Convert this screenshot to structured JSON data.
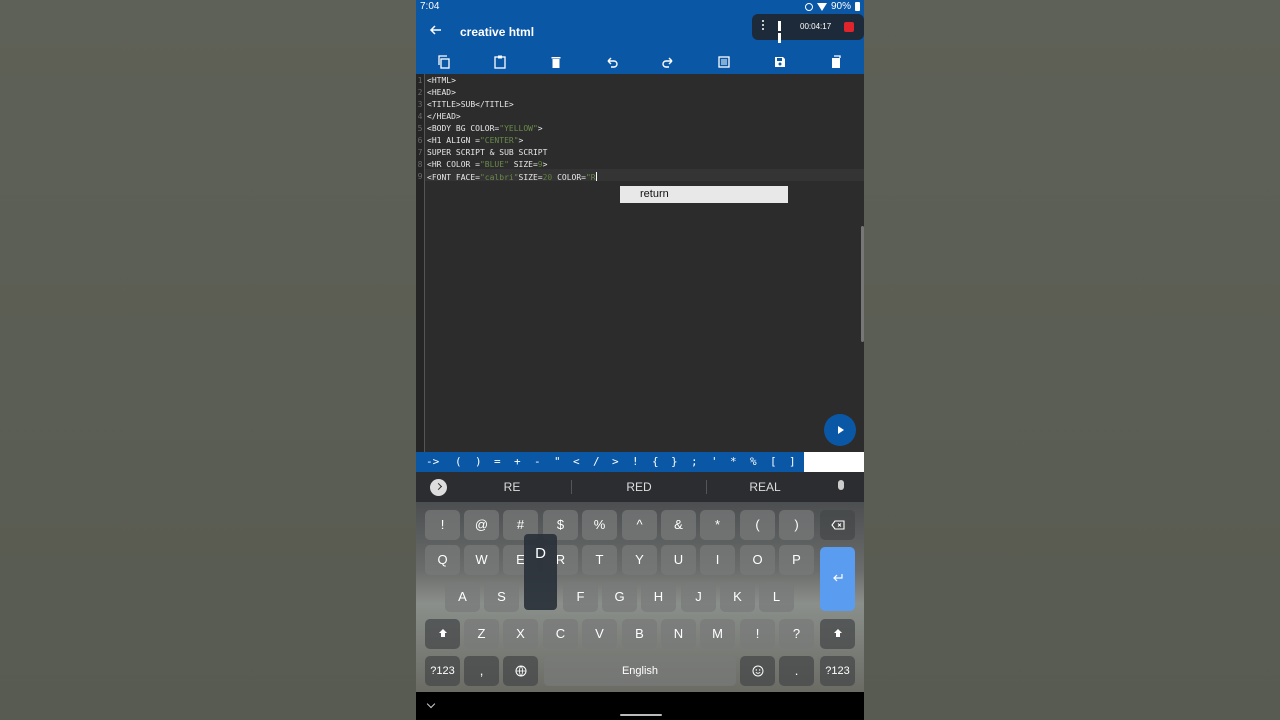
{
  "status": {
    "time": "7:04",
    "battery": "90%"
  },
  "app": {
    "title": "creative html"
  },
  "recorder": {
    "time": "00:04:17"
  },
  "toolbar": {
    "icons": [
      "copy-icon",
      "paste-icon",
      "delete-icon",
      "undo-icon",
      "redo-icon",
      "select-all-icon",
      "save-icon",
      "clipboard-icon"
    ]
  },
  "editor": {
    "line_numbers": [
      "1",
      "2",
      "3",
      "4",
      "5",
      "6",
      "7",
      "8",
      "9"
    ],
    "lines": {
      "l1": "<HTML>",
      "l2": "<HEAD>",
      "l3": "<TITLE>SUB</TITLE>",
      "l4": "</HEAD>",
      "l5a": "<BODY BG COLOR=",
      "l5b": "\"YELLOW\"",
      "l5c": ">",
      "l6a": "<H1 ALIGN =",
      "l6b": "\"CENTER\"",
      "l6c": ">",
      "l7": "SUPER SCRIPT & SUB SCRIPT",
      "l8a": "<HR COLOR =",
      "l8b": "\"BLUE\"",
      "l8c": " SIZE=",
      "l8d": "9",
      "l8e": ">",
      "l9a": "<FONT FACE=",
      "l9b": "\"calbri\"",
      "l9c": "SIZE=",
      "l9d": "20",
      "l9e": " COLOR=",
      "l9f": "\"R"
    },
    "autocomplete": "return"
  },
  "symbols": [
    "->",
    "(",
    ")",
    "=",
    "+",
    "-",
    "\"",
    "<",
    "/",
    ">",
    "!",
    "{",
    "}",
    ";",
    "'",
    "*",
    "%",
    "[",
    "]"
  ],
  "keyboard": {
    "suggestions": [
      "RE",
      "RED",
      "REAL"
    ],
    "row1": [
      "!",
      "@",
      "#",
      "$",
      "%",
      "^",
      "&",
      "*",
      "(",
      ")"
    ],
    "row2": [
      "Q",
      "W",
      "E",
      "R",
      "T",
      "Y",
      "U",
      "I",
      "O",
      "P"
    ],
    "row3": [
      "A",
      "S",
      "F",
      "G",
      "H",
      "J",
      "K",
      "L"
    ],
    "row4": [
      "Z",
      "X",
      "C",
      "V",
      "B",
      "N",
      "M",
      "!",
      "?"
    ],
    "pressed": "D",
    "mode_left": "?123",
    "comma": ",",
    "space": "English",
    "period": ".",
    "mode_right": "?123"
  }
}
